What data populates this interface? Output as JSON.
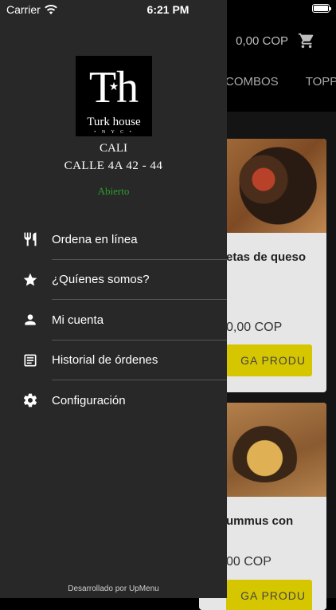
{
  "status_bar": {
    "carrier": "Carrier",
    "time": "6:21 PM"
  },
  "header": {
    "cart_total": "0,00 COP"
  },
  "categories": [
    "COMBOS",
    "TOPPI"
  ],
  "products": [
    {
      "title": "etas de queso",
      "price": "0,00 COP",
      "button": "GA PRODU"
    },
    {
      "title": "ummus con",
      "price": "00 COP",
      "button": "GA PRODU"
    }
  ],
  "drawer": {
    "logo_text": "Turk house",
    "city": "CALI",
    "address": "CALLE 4A 42 - 44",
    "open_status": "Abierto",
    "menu": [
      {
        "label": "Ordena en línea",
        "icon": "fork-knife-icon"
      },
      {
        "label": "¿Quíenes somos?",
        "icon": "star-icon"
      },
      {
        "label": "Mi cuenta",
        "icon": "person-icon"
      },
      {
        "label": "Historial de órdenes",
        "icon": "receipt-icon"
      },
      {
        "label": "Configuración",
        "icon": "gear-icon"
      }
    ],
    "footer": "Desarrollado por UpMenu"
  },
  "colors": {
    "drawer_bg": "#282828",
    "open_green": "#2e9d2e",
    "accent_button": "#d6c600"
  }
}
